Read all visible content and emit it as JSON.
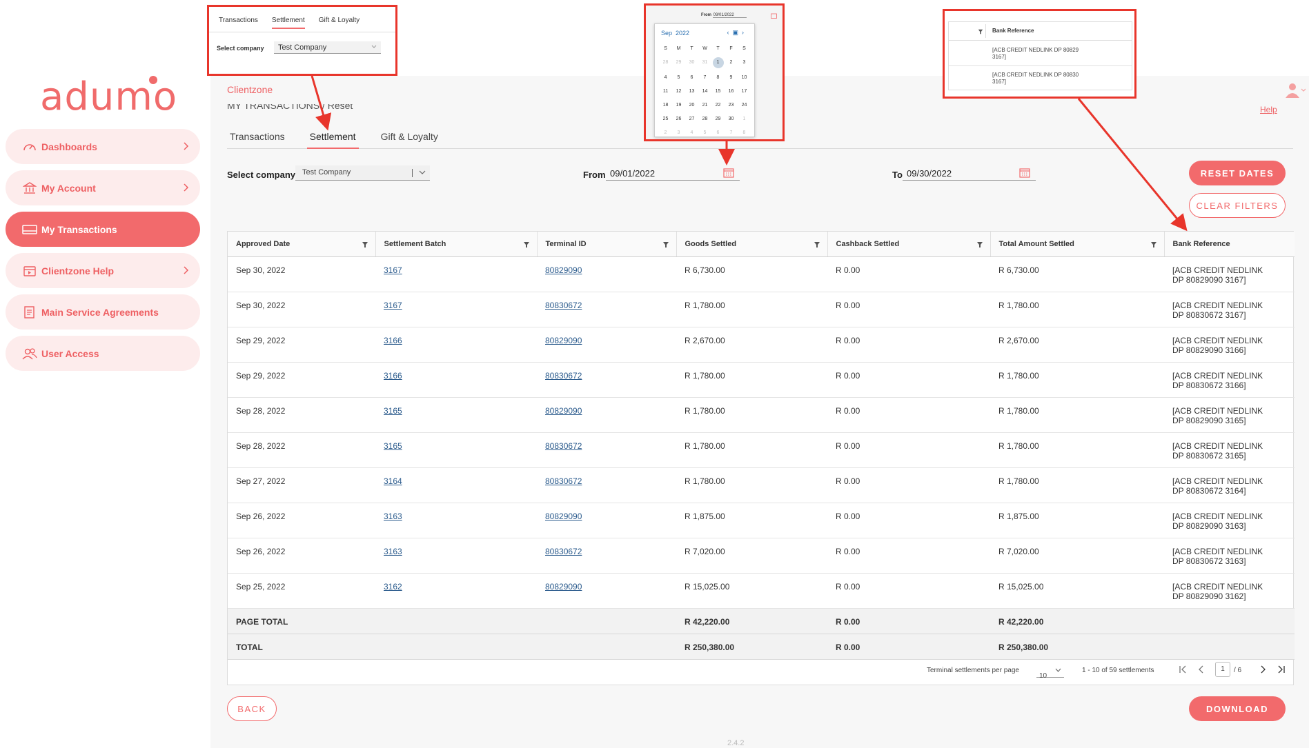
{
  "brand": {
    "logo_text": "adum",
    "logo_tail": "o"
  },
  "sidebar": {
    "items": [
      {
        "label": "Dashboards",
        "icon": "dashboard-gauge-icon"
      },
      {
        "label": "My Account",
        "icon": "bank-icon"
      },
      {
        "label": "My Transactions",
        "icon": "card-icon"
      },
      {
        "label": "Clientzone Help",
        "icon": "help-calendar-icon"
      },
      {
        "label": "Main Service Agreements",
        "icon": "document-icon"
      },
      {
        "label": "User Access",
        "icon": "users-icon"
      }
    ]
  },
  "header": {
    "breadcrumb": "Clientzone",
    "help_label": "Help",
    "page_title_clipped": "MY TRANSACTIONS / Reset"
  },
  "tabs": [
    "Transactions",
    "Settlement",
    "Gift & Loyalty"
  ],
  "filters": {
    "company_label": "Select company",
    "company_value": "Test Company",
    "from_label": "From",
    "from_value": "09/01/2022",
    "to_label": "To",
    "to_value": "09/30/2022"
  },
  "buttons": {
    "reset_dates": "RESET DATES",
    "clear_filters": "CLEAR FILTERS",
    "back": "BACK",
    "download": "DOWNLOAD"
  },
  "table": {
    "columns": [
      "Approved Date",
      "Settlement Batch",
      "Terminal ID",
      "Goods Settled",
      "Cashback Settled",
      "Total Amount Settled",
      "Bank Reference"
    ],
    "rows": [
      [
        "Sep 30, 2022",
        "3167",
        "80829090",
        "R 6,730.00",
        "R 0.00",
        "R 6,730.00",
        "[ACB CREDIT NEDLINK",
        "DP 80829090 3167]"
      ],
      [
        "Sep 30, 2022",
        "3167",
        "80830672",
        "R 1,780.00",
        "R 0.00",
        "R 1,780.00",
        "[ACB CREDIT NEDLINK",
        "DP 80830672 3167]"
      ],
      [
        "Sep 29, 2022",
        "3166",
        "80829090",
        "R 2,670.00",
        "R 0.00",
        "R 2,670.00",
        "[ACB CREDIT NEDLINK",
        "DP 80829090 3166]"
      ],
      [
        "Sep 29, 2022",
        "3166",
        "80830672",
        "R 1,780.00",
        "R 0.00",
        "R 1,780.00",
        "[ACB CREDIT NEDLINK",
        "DP 80830672 3166]"
      ],
      [
        "Sep 28, 2022",
        "3165",
        "80829090",
        "R 1,780.00",
        "R 0.00",
        "R 1,780.00",
        "[ACB CREDIT NEDLINK",
        "DP 80829090 3165]"
      ],
      [
        "Sep 28, 2022",
        "3165",
        "80830672",
        "R 1,780.00",
        "R 0.00",
        "R 1,780.00",
        "[ACB CREDIT NEDLINK",
        "DP 80830672 3165]"
      ],
      [
        "Sep 27, 2022",
        "3164",
        "80830672",
        "R 1,780.00",
        "R 0.00",
        "R 1,780.00",
        "[ACB CREDIT NEDLINK",
        "DP 80830672 3164]"
      ],
      [
        "Sep 26, 2022",
        "3163",
        "80829090",
        "R 1,875.00",
        "R 0.00",
        "R 1,875.00",
        "[ACB CREDIT NEDLINK",
        "DP 80829090 3163]"
      ],
      [
        "Sep 26, 2022",
        "3163",
        "80830672",
        "R 7,020.00",
        "R 0.00",
        "R 7,020.00",
        "[ACB CREDIT NEDLINK",
        "DP 80830672 3163]"
      ],
      [
        "Sep 25, 2022",
        "3162",
        "80829090",
        "R 15,025.00",
        "R 0.00",
        "R 15,025.00",
        "[ACB CREDIT NEDLINK",
        "DP 80829090 3162]"
      ]
    ],
    "page_total": {
      "label": "PAGE TOTAL",
      "goods": "R 42,220.00",
      "cashback": "R 0.00",
      "total": "R 42,220.00"
    },
    "total": {
      "label": "TOTAL",
      "goods": "R 250,380.00",
      "cashback": "R 0.00",
      "total": "R 250,380.00"
    }
  },
  "pager": {
    "per_page_label": "Terminal settlements per page",
    "per_page_value": "10",
    "range": "1 - 10 of 59 settlements",
    "current_page": "1",
    "page_of": "/ 6"
  },
  "version": "2.4.2",
  "callout_calendar": {
    "from_label": "From",
    "from_value": "09/01/2022",
    "month": "Sep",
    "year": "2022",
    "weekdays": [
      "S",
      "M",
      "T",
      "W",
      "T",
      "F",
      "S"
    ],
    "days": [
      "28",
      "29",
      "30",
      "31",
      "1",
      "2",
      "3",
      "4",
      "5",
      "6",
      "7",
      "8",
      "9",
      "10",
      "11",
      "12",
      "13",
      "14",
      "15",
      "16",
      "17",
      "18",
      "19",
      "20",
      "21",
      "22",
      "23",
      "24",
      "25",
      "26",
      "27",
      "28",
      "29",
      "30",
      "1",
      "2",
      "3",
      "4",
      "5",
      "6",
      "7",
      "8"
    ]
  },
  "callout_bank": {
    "header": "Bank Reference",
    "lines": [
      "[ACB CREDIT NEDLINK DP 80829",
      "3167]",
      "[ACB CREDIT NEDLINK DP 80830",
      "3167]"
    ]
  },
  "colors": {
    "accent": "#f26a6c",
    "callout": "#e8352b",
    "link": "#2a5a8c"
  }
}
